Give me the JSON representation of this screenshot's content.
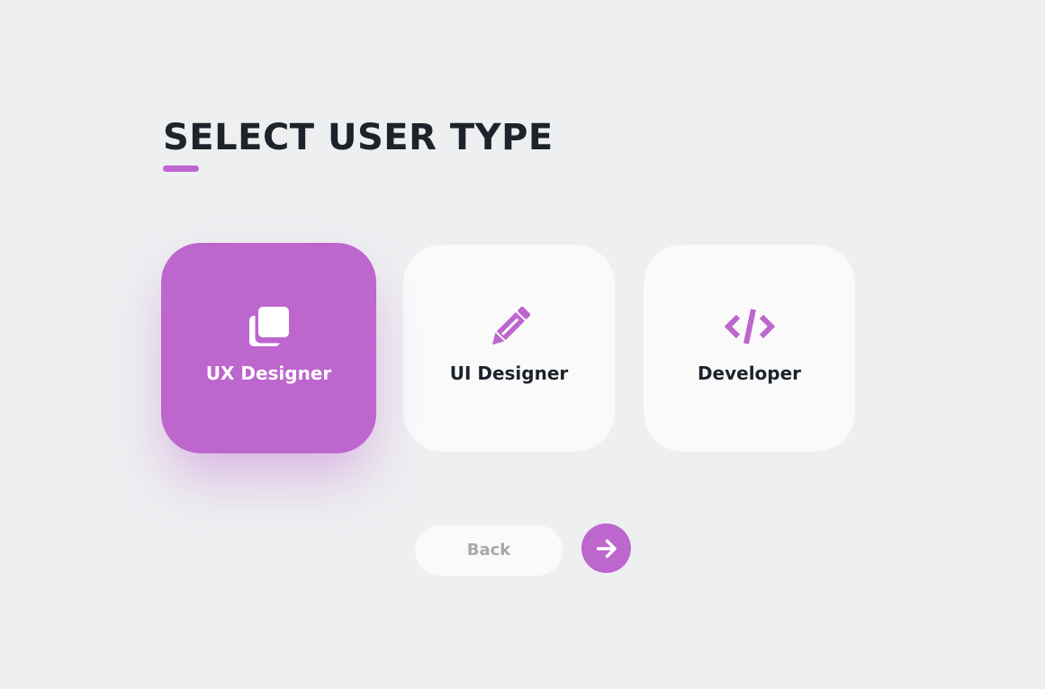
{
  "header": {
    "title": "SELECT USER TYPE"
  },
  "colors": {
    "accent": "#bd66ce",
    "background": "#eeeff1",
    "card": "#fafafb",
    "text": "#1d232b",
    "muted_text": "#a8a8ab"
  },
  "user_types": [
    {
      "label": "UX Designer",
      "icon": "copy-icon",
      "selected": true
    },
    {
      "label": "UI Designer",
      "icon": "pencil-icon",
      "selected": false
    },
    {
      "label": "Developer",
      "icon": "code-icon",
      "selected": false
    }
  ],
  "actions": {
    "back_label": "Back",
    "next_icon": "arrow-right-icon"
  }
}
